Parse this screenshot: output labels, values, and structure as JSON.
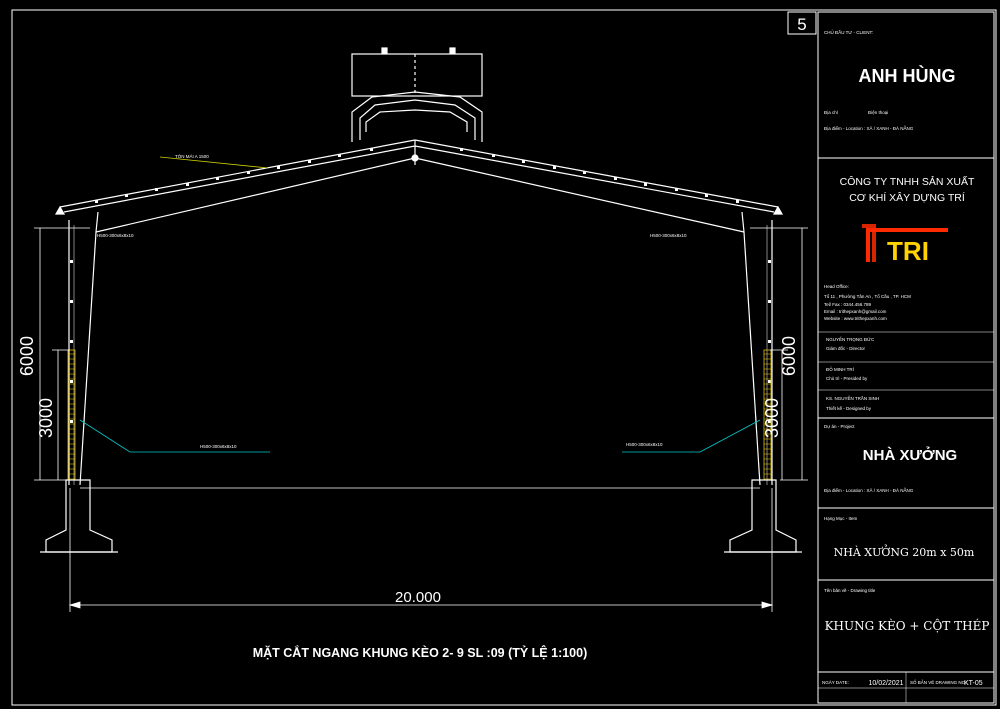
{
  "sheet_number": "5",
  "drawing": {
    "overall_span": "20.000",
    "left_height_total": "6000",
    "left_height_lower": "3000",
    "right_height_total": "6000",
    "right_height_lower": "3000",
    "caption": "MẶT CẮT NGANG KHUNG KÈO 2- 9 SL :09 (TỶ LỆ 1:100)",
    "roof_note": "TÔN MÁI A 1500",
    "rafter_left_note": "H500-300x6x8x10",
    "rafter_right_note": "H500-300x6x8x10",
    "column_left_note": "H500-300x6x8x10",
    "column_right_note": "H500-300x6x8x10"
  },
  "title_block": {
    "client_label": "CHỦ ĐẦU TƯ - CLIENT:",
    "client_name": "ANH HÙNG",
    "address_label": "Địa chỉ",
    "phone_label": "Điện thoại",
    "location_label": "Địa điểm - Location : XÃ / XANH - ĐÀ NẴNG",
    "company_line1": "CÔNG TY TNHH SẢN XUẤT",
    "company_line2": "CƠ KHÍ XÂY DỰNG TRÍ",
    "logo_text": "TRI",
    "company_info": [
      "Head Office:",
      "Tổ 11 , Phường Tân An , Tổ Cầu , TP. HCM",
      "Tel/ Fax : 0344.456.789",
      "Email : trithepxanh@gmail.com",
      "Website : www.trithepxanh.com"
    ],
    "director_label": "NGUYỄN TRỌNG ĐỨC",
    "director_role": "Giám đốc - Director",
    "designer_label": "ĐỖ MINH TRÍ",
    "designer_role": "Chủ trì - Presided by",
    "checker_label": "KS. NGUYỄN TRẦN SINH",
    "checker_role": "Thiết kế - Designed by",
    "project_label": "Dự án - Project",
    "project_name": "NHÀ XƯỞNG",
    "project_location": "Địa điểm - Location : XÃ / XANH - ĐÀ NẴNG",
    "item_label": "Hạng Mục - Item",
    "item_name": "NHÀ XƯỞNG 20m x 50m",
    "drawing_title_label": "Tên bản vẽ - Drawing title",
    "drawing_title": "KHUNG KÈO + CỘT THÉP",
    "date_label": "NGÀY DATE:",
    "date_value": "10/02/2021",
    "drawing_no_label": "SỐ BẢN VẼ DRAWING NO.:",
    "drawing_no_value": "KT-05"
  },
  "colors": {
    "background": "#000000",
    "lines": "#ffffff",
    "leader": "#00c8c8",
    "logo_red": "#ff2a00",
    "logo_yellow": "#ffd200"
  }
}
